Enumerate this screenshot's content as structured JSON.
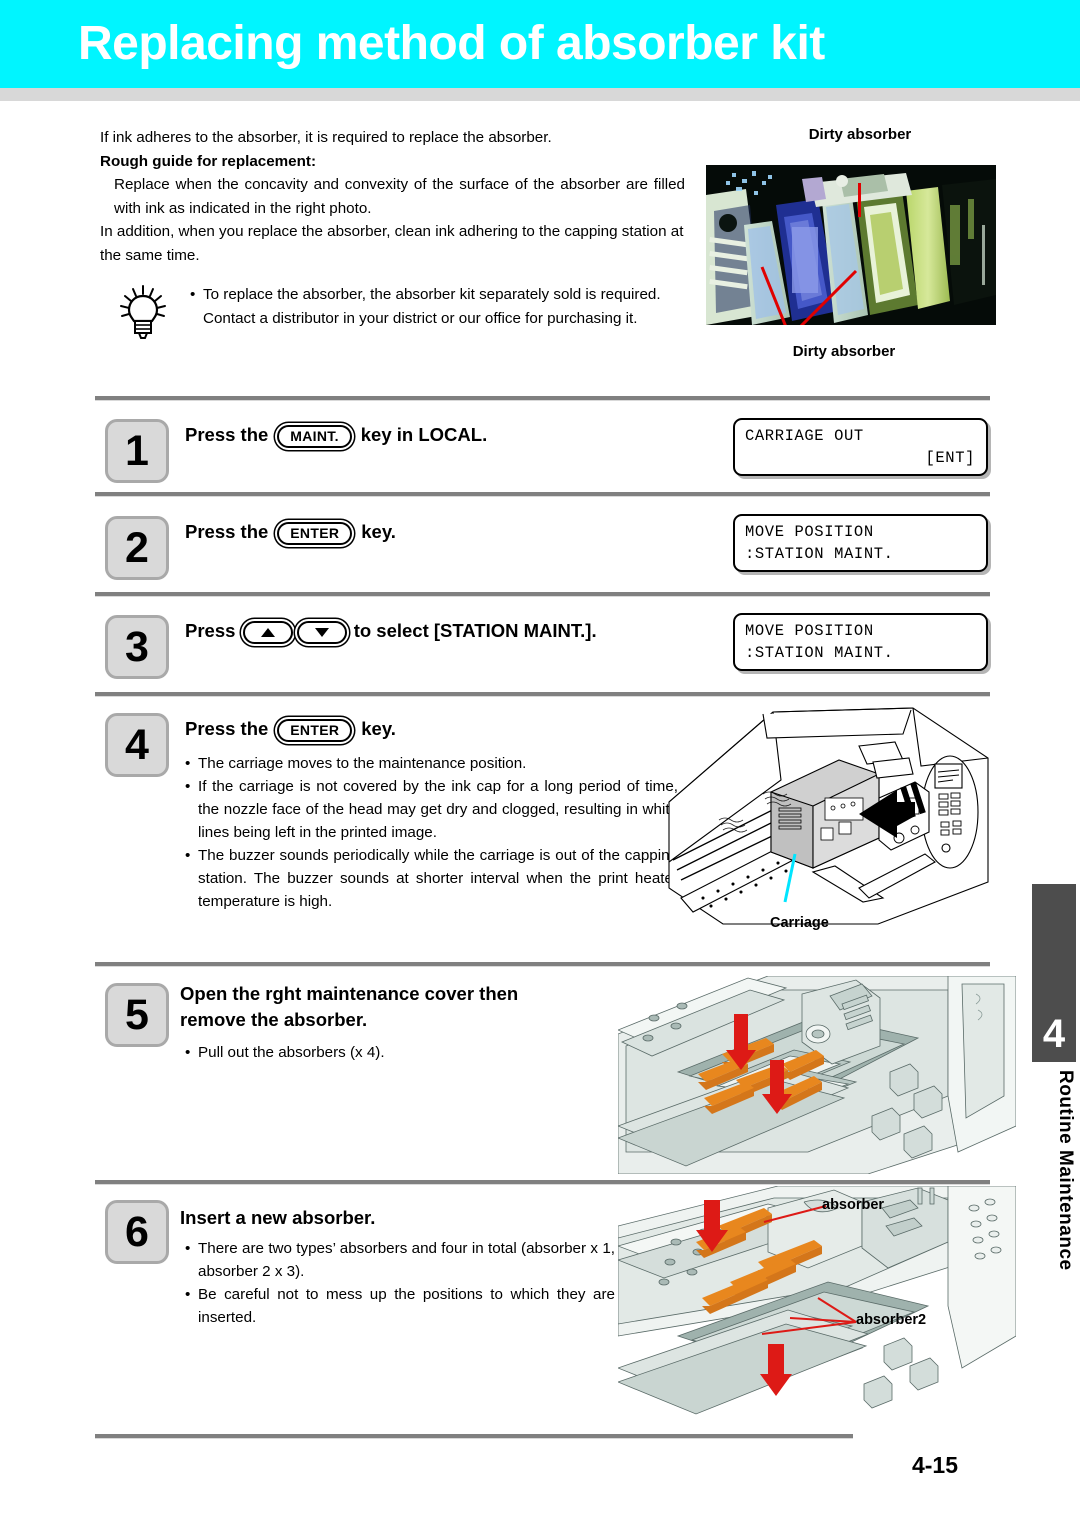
{
  "header": {
    "title": "Replacing method of absorber kit",
    "banner_color": "#00F5FF",
    "underbar_color": "#d8d8d8"
  },
  "intro": {
    "line1": "If ink adheres to the absorber, it is required to replace the absorber.",
    "heading": "Rough guide for replacement:",
    "indented1": "Replace when the concavity and convexity of the surface of the absorber are filled with ink as indicated in the right photo.",
    "line2": "In addition, when you replace the absorber, clean ink adhering to the capping station at the same time."
  },
  "tip": {
    "icon": "lightbulb-icon",
    "bullet": "To replace the absorber, the absorber kit separately sold is required. Contact a distributor in your district or our office for purchasing it."
  },
  "photo": {
    "label_top": "Dirty absorber",
    "label_bottom": "Dirty absorber",
    "callout_color": "#e00000"
  },
  "steps": [
    {
      "number": "1",
      "title_pre": "Press the",
      "key": "MAINT.",
      "title_post": "key in LOCAL.",
      "lcd": {
        "line1": "CARRIAGE OUT",
        "line2": "[ENT]",
        "line2_align": "right"
      }
    },
    {
      "number": "2",
      "title_pre": "Press the",
      "key": "ENTER",
      "title_post": "key.",
      "lcd": {
        "line1": "MOVE POSITION",
        "line2": ":STATION MAINT.",
        "line2_align": "left"
      }
    },
    {
      "number": "3",
      "title_pre": "Press",
      "key_up": "up-arrow",
      "key_down": "down-arrow",
      "title_post": "to select [STATION MAINT.].",
      "lcd": {
        "line1": "MOVE POSITION",
        "line2": ":STATION MAINT.",
        "line2_align": "left"
      }
    },
    {
      "number": "4",
      "title_pre": "Press the",
      "key": "ENTER",
      "title_post": "key.",
      "bullets": [
        "The carriage moves to the maintenance position.",
        "If the carriage is not covered by the ink cap for a long period of time, the nozzle face of the head may get dry and clogged, resulting in white lines being left in the printed image.",
        "The buzzer sounds periodically while the carriage is out of the capping station. The buzzer sounds at shorter interval when the print heater temperature is high."
      ],
      "illustration_callout": "Carriage"
    },
    {
      "number": "5",
      "title": "Open the rght maintenance cover then remove the absorber.",
      "bullets": [
        "Pull out the absorbers (x 4)."
      ]
    },
    {
      "number": "6",
      "title": "Insert a new absorber.",
      "bullets": [
        "There are two types’ absorbers and four in total (absorber x 1, absorber 2 x 3).",
        "Be careful not to mess up the positions to which they are inserted."
      ],
      "illustration_callouts": [
        "absorber",
        "absorber2"
      ]
    }
  ],
  "margin_tab": {
    "chapter_number": "4",
    "chapter_title": "Routine Maintenance",
    "block_color": "#4d4d4d"
  },
  "footer": {
    "page_number": "4-15"
  }
}
